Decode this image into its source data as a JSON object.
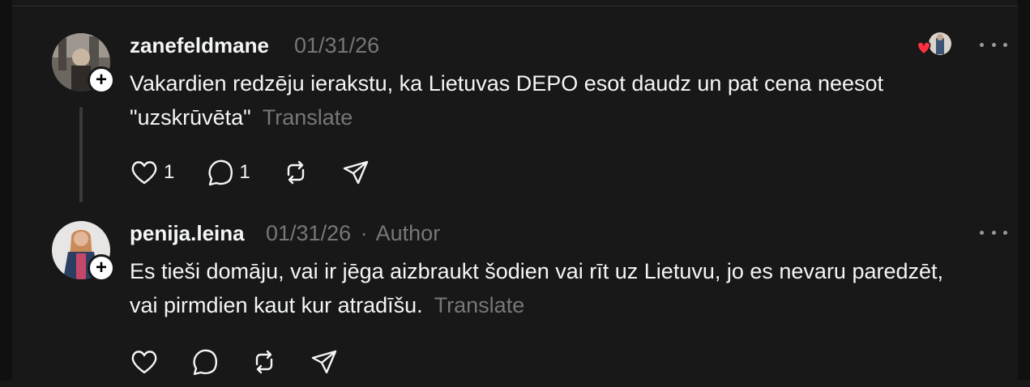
{
  "posts": [
    {
      "username": "zanefeldmane",
      "date": "01/31/26",
      "author_tag": "",
      "text": "Vakardien redzēju ierakstu, ka Lietuvas DEPO esot daudz un pat cena neesot \"uzskrūvēta\"",
      "translate_label": "Translate",
      "like_count": "1",
      "reply_count": "1"
    },
    {
      "username": "penija.leina",
      "date": "01/31/26",
      "separator": "·",
      "author_tag": "Author",
      "text": "Es tieši domāju, vai ir jēga aizbraukt šodien vai rīt uz Lietuvu, jo es nevaru paredzēt, vai pirmdien kaut kur atradīšu.",
      "translate_label": "Translate",
      "like_count": "",
      "reply_count": ""
    }
  ],
  "icons": {
    "follow": "plus-icon",
    "more": "more-icon",
    "like": "heart-icon",
    "reply": "reply-icon",
    "repost": "repost-icon",
    "share": "share-icon"
  },
  "colors": {
    "background": "#181818",
    "text": "#f3f5f7",
    "muted": "#777777",
    "like_red": "#ff3040"
  }
}
